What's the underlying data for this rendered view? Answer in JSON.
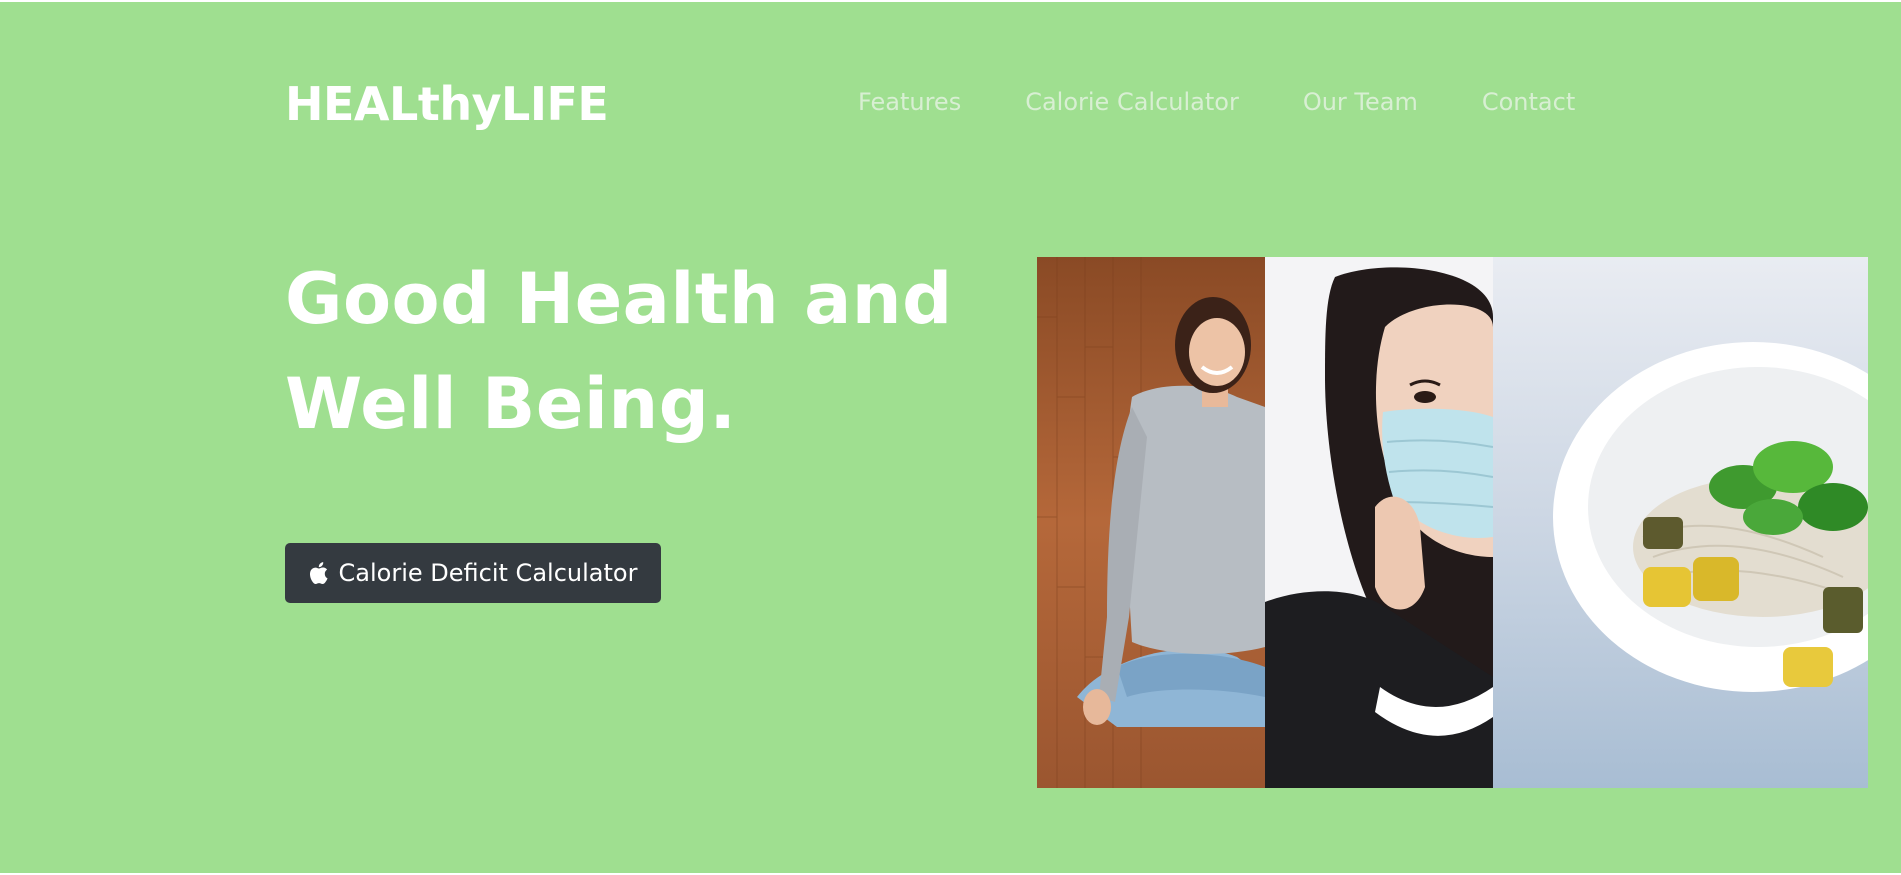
{
  "brand": {
    "name": "HEALthyLIFE"
  },
  "nav": {
    "items": [
      "Features",
      "Calorie Calculator",
      "Our Team",
      "Contact"
    ]
  },
  "hero": {
    "headline_line1": "Good Health and",
    "headline_line2": "Well Being.",
    "cta_label": "Calorie Deficit Calculator",
    "cta_icon": "apple-icon"
  },
  "photos": [
    {
      "subject": "woman sitting cross-legged on wooden floor"
    },
    {
      "subject": "woman wearing a face mask"
    },
    {
      "subject": "bowl of noodles and greens"
    }
  ],
  "colors": {
    "background": "#9fdf90",
    "text": "#ffffff",
    "nav_text": "#d8efd3",
    "button": "#343a40"
  }
}
